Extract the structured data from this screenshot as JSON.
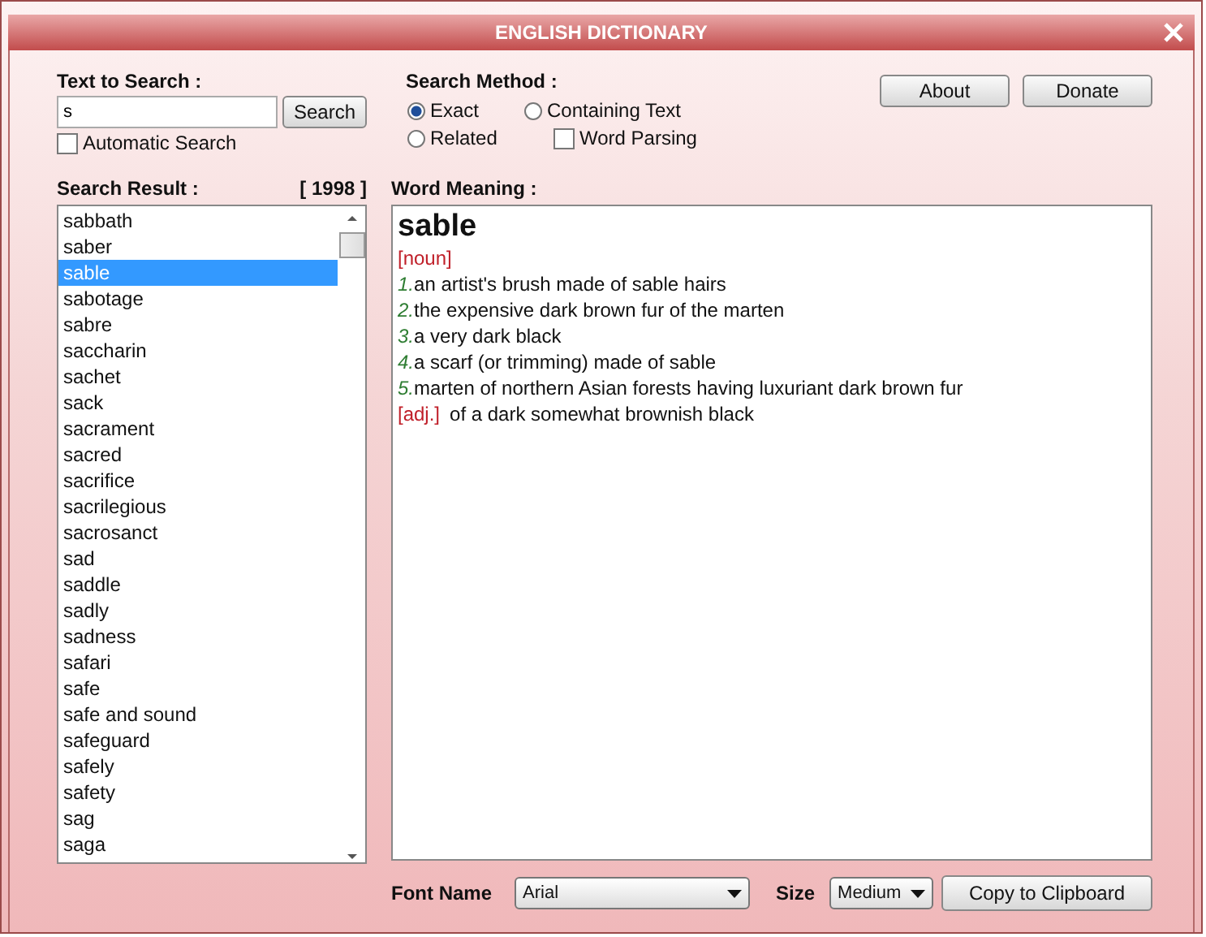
{
  "window": {
    "title": "ENGLISH DICTIONARY"
  },
  "search": {
    "label": "Text to Search :",
    "value": "s",
    "button": "Search",
    "automatic": {
      "label": "Automatic Search",
      "checked": false
    }
  },
  "method": {
    "label": "Search Method :",
    "options": [
      {
        "label": "Exact",
        "selected": true
      },
      {
        "label": "Containing Text",
        "selected": false
      },
      {
        "label": "Related",
        "selected": false
      }
    ],
    "word_parsing": {
      "label": "Word Parsing",
      "checked": false
    }
  },
  "buttons": [
    "About",
    "Donate"
  ],
  "results": {
    "label": "Search Result :",
    "count": "[ 1998 ]",
    "items": [
      {
        "text": "sabbath",
        "selected": false
      },
      {
        "text": "saber",
        "selected": false
      },
      {
        "text": "sable",
        "selected": true
      },
      {
        "text": "sabotage",
        "selected": false
      },
      {
        "text": "sabre",
        "selected": false
      },
      {
        "text": "saccharin",
        "selected": false
      },
      {
        "text": "sachet",
        "selected": false
      },
      {
        "text": "sack",
        "selected": false
      },
      {
        "text": "sacrament",
        "selected": false
      },
      {
        "text": "sacred",
        "selected": false
      },
      {
        "text": "sacrifice",
        "selected": false
      },
      {
        "text": "sacrilegious",
        "selected": false
      },
      {
        "text": "sacrosanct",
        "selected": false
      },
      {
        "text": "sad",
        "selected": false
      },
      {
        "text": "saddle",
        "selected": false
      },
      {
        "text": "sadly",
        "selected": false
      },
      {
        "text": "sadness",
        "selected": false
      },
      {
        "text": "safari",
        "selected": false
      },
      {
        "text": "safe",
        "selected": false
      },
      {
        "text": "safe and sound",
        "selected": false
      },
      {
        "text": "safeguard",
        "selected": false
      },
      {
        "text": "safely",
        "selected": false
      },
      {
        "text": "safety",
        "selected": false
      },
      {
        "text": "sag",
        "selected": false
      },
      {
        "text": "saga",
        "selected": false
      }
    ]
  },
  "meaning": {
    "label": "Word Meaning :",
    "word": "sable",
    "lines": [
      {
        "kind": "pos",
        "text": "[noun]"
      },
      {
        "kind": "sense",
        "number": "1.",
        "text": "an artist's brush made of sable hairs"
      },
      {
        "kind": "sense",
        "number": "2.",
        "text": "the expensive dark brown fur of the marten"
      },
      {
        "kind": "sense",
        "number": "3.",
        "text": "a very dark black"
      },
      {
        "kind": "sense",
        "number": "4.",
        "text": "a scarf (or trimming) made of sable"
      },
      {
        "kind": "sense",
        "number": "5.",
        "text": "marten of northern Asian forests having luxuriant dark brown fur"
      },
      {
        "kind": "pos_sense",
        "pos": "[adj.]",
        "text": "of a dark somewhat brownish black"
      }
    ]
  },
  "footer": {
    "font_label": "Font Name",
    "font_value": "Arial",
    "size_label": "Size",
    "size_value": "Medium",
    "copy_button": "Copy to Clipboard"
  }
}
